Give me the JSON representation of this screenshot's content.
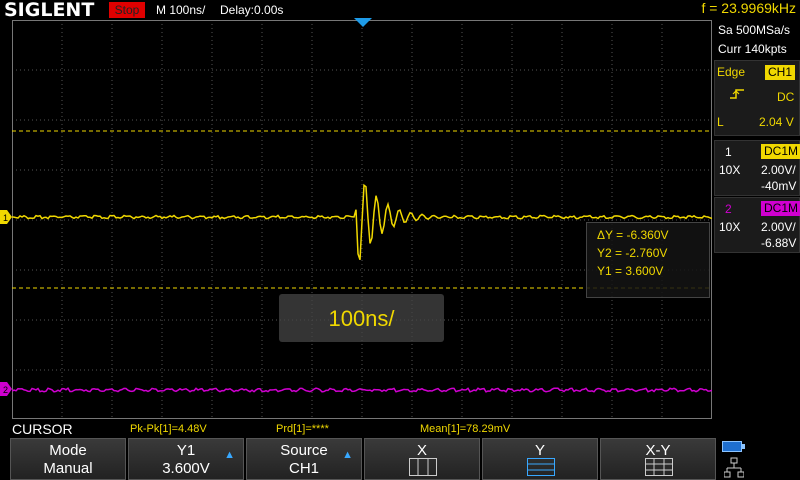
{
  "header": {
    "brand": "SIGLENT",
    "run_state": "Stop",
    "timebase": "M 100ns/",
    "delay": "Delay:0.00s",
    "frequency": "f = 23.9969kHz"
  },
  "acquisition": {
    "sample_rate": "Sa 500MSa/s",
    "memory_depth": "Curr 140kpts"
  },
  "trigger": {
    "type": "Edge",
    "source": "CH1",
    "coupling": "DC",
    "slope_icon": "rising-edge-icon",
    "level_label": "L",
    "level": "2.04 V"
  },
  "channels": [
    {
      "number": "1",
      "coupling": "DC1M",
      "probe": "10X",
      "scale": "2.00V/",
      "offset": "-40mV",
      "color": "#f0d800"
    },
    {
      "number": "2",
      "coupling": "DC1M",
      "probe": "10X",
      "scale": "2.00V/",
      "offset": "-6.88V",
      "color": "#d000d0"
    }
  ],
  "cursor_readout": {
    "delta_y": "ΔY = -6.360V",
    "y2": "Y2 = -2.760V",
    "y1": "Y1 = 3.600V"
  },
  "timebase_overlay": "100ns/",
  "status": {
    "mode_label": "CURSOR",
    "pk_pk": "Pk-Pk[1]=4.48V",
    "period": "Prd[1]=****",
    "mean": "Mean[1]=78.29mV"
  },
  "softkeys": [
    {
      "line1": "Mode",
      "line2": "Manual",
      "arrow": false
    },
    {
      "line1": "Y1",
      "line2": "3.600V",
      "arrow": true
    },
    {
      "line1": "Source",
      "line2": "CH1",
      "arrow": true
    },
    {
      "line1": "X",
      "line2": "",
      "icon": "x-cursor-icon"
    },
    {
      "line1": "Y",
      "line2": "",
      "icon": "y-cursor-icon"
    },
    {
      "line1": "X-Y",
      "line2": "",
      "icon": "xy-cursor-icon"
    }
  ],
  "colors": {
    "ch1": "#f0d800",
    "ch2": "#d000d0",
    "trigger_marker": "#1e9be8",
    "stop": "#e00000"
  }
}
